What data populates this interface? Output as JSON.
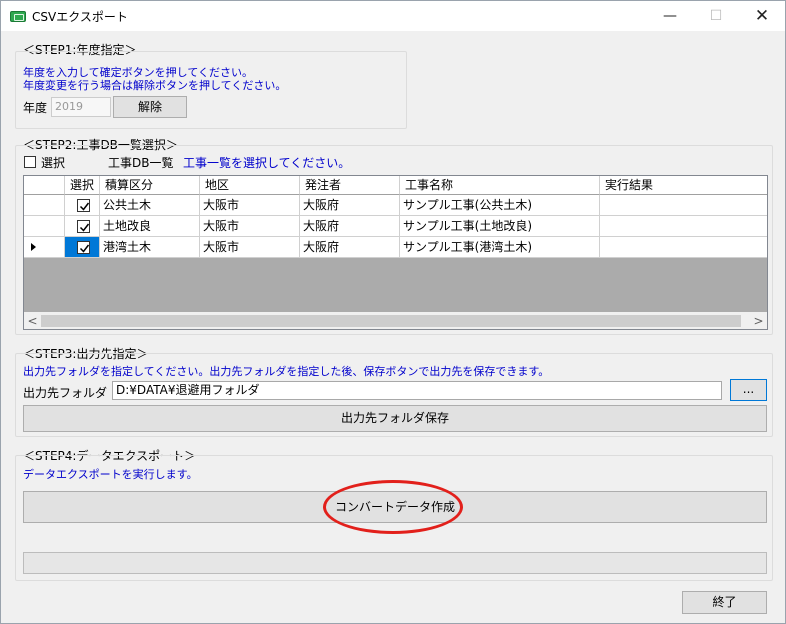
{
  "window": {
    "title": "CSVエクスポート",
    "minimize": "—",
    "maximize": "☐",
    "close": "✕"
  },
  "step1": {
    "label": "＜STEP1:年度指定＞",
    "desc1": "年度を入力して確定ボタンを押してください。",
    "desc2": "年度変更を行う場合は解除ボタンを押してください。",
    "year_label": "年度",
    "year_value": "2019",
    "release_button": "解除"
  },
  "step2": {
    "label": "＜STEP2:工事DB一覧選択＞",
    "select_all_label": "選択",
    "list_label": "工事DB一覧",
    "list_hint": "工事一覧を選択してください。",
    "columns": [
      "選択",
      "積算区分",
      "地区",
      "発注者",
      "工事名称",
      "実行結果"
    ],
    "rows": [
      {
        "checked": true,
        "category": "公共土木",
        "district": "大阪市",
        "client": "大阪府",
        "name": "サンプル工事(公共土木)",
        "result": ""
      },
      {
        "checked": true,
        "category": "土地改良",
        "district": "大阪市",
        "client": "大阪府",
        "name": "サンプル工事(土地改良)",
        "result": ""
      },
      {
        "checked": true,
        "category": "港湾土木",
        "district": "大阪市",
        "client": "大阪府",
        "name": "サンプル工事(港湾土木)",
        "result": ""
      }
    ],
    "scroll_left": "<",
    "scroll_right": ">"
  },
  "step3": {
    "label": "＜STEP3:出力先指定＞",
    "desc": "出力先フォルダを指定してください。出力先フォルダを指定した後、保存ボタンで出力先を保存できます。",
    "folder_label": "出力先フォルダ",
    "folder_value": "D:¥DATA¥退避用フォルダ",
    "browse_button": "...",
    "save_button": "出力先フォルダ保存"
  },
  "step4": {
    "label": "＜STEP4:データエクスポート＞",
    "desc": "データエクスポートを実行します。",
    "convert_button": "コンバートデータ作成"
  },
  "footer": {
    "exit_button": "終了"
  },
  "colors": {
    "accent": "#0078d7",
    "highlight": "#e2201b",
    "hint_text": "#0000cc"
  }
}
